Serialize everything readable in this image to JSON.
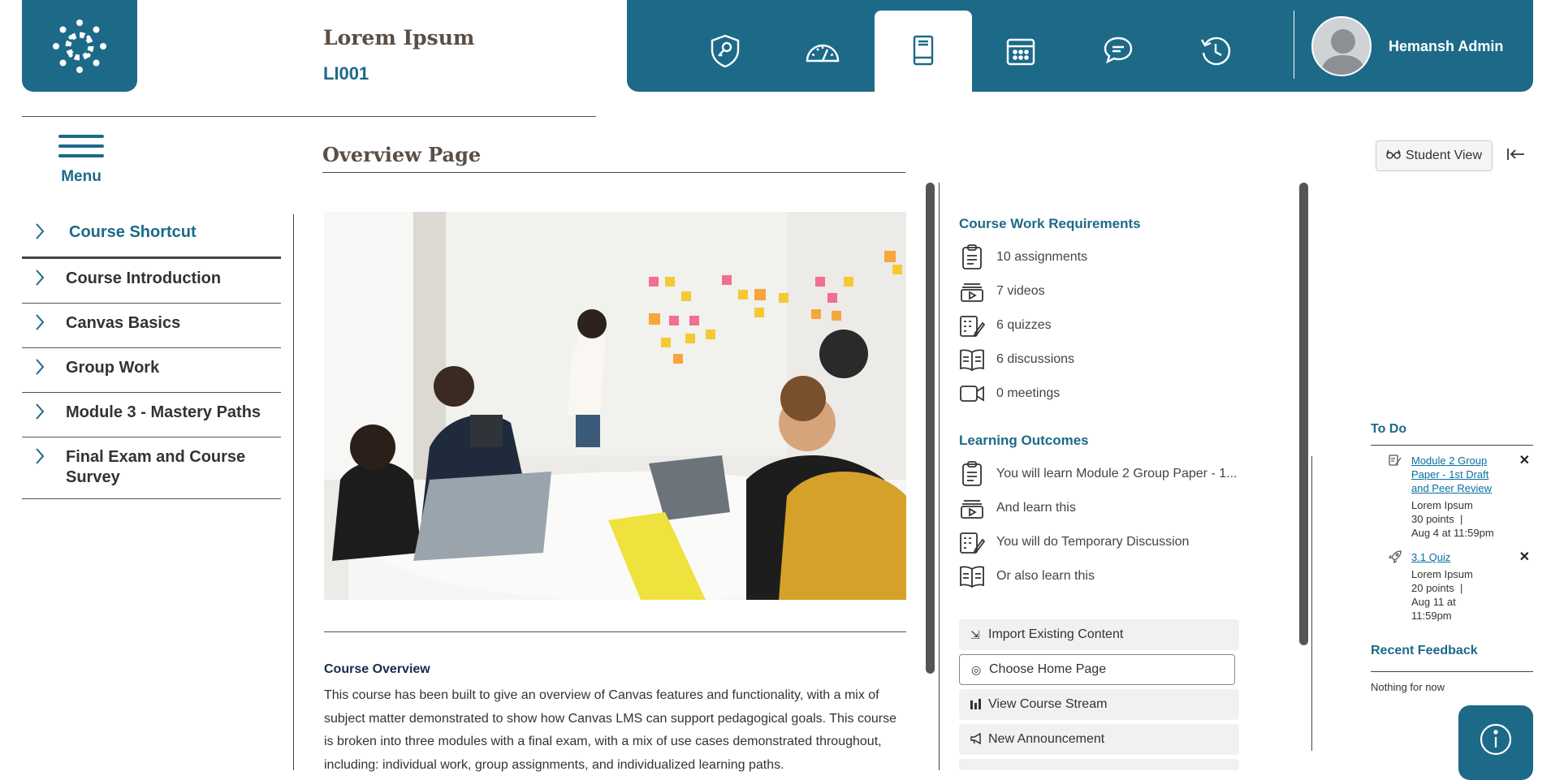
{
  "header": {
    "course_title": "Lorem Ipsum",
    "course_code": "LI001",
    "logo_icon": "canvas-logo-icon",
    "nav_icons": [
      "shield-key-icon",
      "dashboard-gauge-icon",
      "book-icon",
      "calendar-icon",
      "chat-icon",
      "history-icon"
    ],
    "active_nav": "book-icon",
    "user_name": "Hemansh Admin"
  },
  "menu": {
    "label": "Menu"
  },
  "sidebar": {
    "items": [
      {
        "label": "Course Shortcut"
      },
      {
        "label": "Course Introduction"
      },
      {
        "label": "Canvas Basics"
      },
      {
        "label": "Group Work"
      },
      {
        "label": "Module 3 - Mastery Paths"
      },
      {
        "label": "Final Exam and Course Survey"
      }
    ]
  },
  "main": {
    "page_title": "Overview Page",
    "overview_heading": "Course Overview",
    "overview_text": "This course has been built to give an overview of Canvas features and functionality, with a mix of subject matter demonstrated to show how Canvas LMS can support pedagogical goals. This course is broken into three modules with a final exam, with a mix of use cases demonstrated throughout, including: individual work, group assignments, and individualized learning paths."
  },
  "requirements": {
    "title": "Course Work Requirements",
    "items": [
      {
        "icon": "assignment-icon",
        "label": "10 assignments"
      },
      {
        "icon": "video-icon",
        "label": "7 videos"
      },
      {
        "icon": "quiz-icon",
        "label": "6 quizzes"
      },
      {
        "icon": "discussion-icon",
        "label": "6 discussions"
      },
      {
        "icon": "meeting-icon",
        "label": "0 meetings"
      }
    ]
  },
  "outcomes": {
    "title": "Learning Outcomes",
    "items": [
      {
        "icon": "assignment-icon",
        "label": "You will learn Module 2 Group Paper - 1..."
      },
      {
        "icon": "video-icon",
        "label": "And learn this"
      },
      {
        "icon": "quiz-icon",
        "label": "You will do Temporary Discussion"
      },
      {
        "icon": "discussion-icon",
        "label": "Or also learn this"
      }
    ]
  },
  "actions": [
    {
      "icon": "import-icon",
      "label": "Import Existing Content"
    },
    {
      "icon": "home-target-icon",
      "label": "Choose Home Page"
    },
    {
      "icon": "bar-chart-icon",
      "label": "View Course Stream"
    },
    {
      "icon": "megaphone-icon",
      "label": "New Announcement"
    }
  ],
  "right": {
    "student_view": "Student View",
    "todo_title": "To Do",
    "todos": [
      {
        "title": "Module 2 Group Paper - 1st Draft and Peer Review",
        "course": "Lorem Ipsum",
        "points": "30 points",
        "due": "Aug 4 at 11:59pm"
      },
      {
        "title": "3.1 Quiz",
        "course": "Lorem Ipsum",
        "points": "20 points",
        "due": "Aug 11 at 11:59pm"
      }
    ],
    "recent_feedback_title": "Recent Feedback",
    "recent_feedback_empty": "Nothing for now"
  },
  "colors": {
    "brand": "#1c6a88",
    "title": "#5b4e44"
  }
}
